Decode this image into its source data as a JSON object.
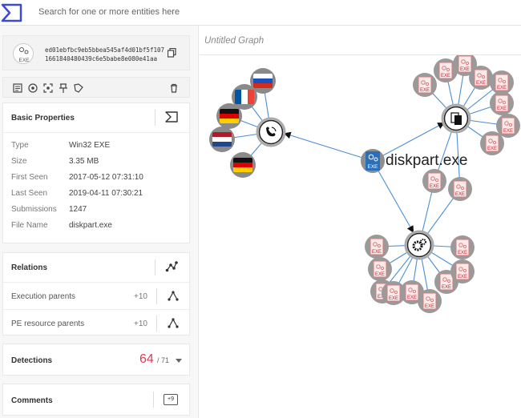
{
  "topbar": {
    "search_placeholder": "Search for one or more entities here"
  },
  "file": {
    "type_badge": "EXE",
    "hash_line1": "ed01ebfbc9eb5bbea545af4d01bf5f107",
    "hash_line2": "1661840480439c6e5babe8e080e41aa"
  },
  "basic_properties": {
    "title": "Basic Properties",
    "rows": [
      {
        "key": "Type",
        "value": "Win32 EXE"
      },
      {
        "key": "Size",
        "value": "3.35 MB"
      },
      {
        "key": "First Seen",
        "value": "2017-05-12 07:31:10"
      },
      {
        "key": "Last Seen",
        "value": "2019-04-11 07:30:21"
      },
      {
        "key": "Submissions",
        "value": "1247"
      },
      {
        "key": "File Name",
        "value": "diskpart.exe"
      }
    ]
  },
  "relations": {
    "title": "Relations",
    "items": [
      {
        "label": "Execution parents",
        "count": "+10"
      },
      {
        "label": "PE resource parents",
        "count": "+10"
      }
    ]
  },
  "detections": {
    "title": "Detections",
    "score": "64",
    "total": "/ 71"
  },
  "comments": {
    "title": "Comments",
    "badge": "+9"
  },
  "graph": {
    "title": "Untitled Graph",
    "center_label": "diskpart.exe",
    "exe_badge": "EXE",
    "countries": [
      "Russia",
      "France",
      "Germany",
      "Netherlands",
      "Germany"
    ]
  },
  "colors": {
    "accent": "#3b4bd8",
    "detection": "#e03a52",
    "edge": "#4a8fd6",
    "exe_node": "#d87a7a"
  }
}
